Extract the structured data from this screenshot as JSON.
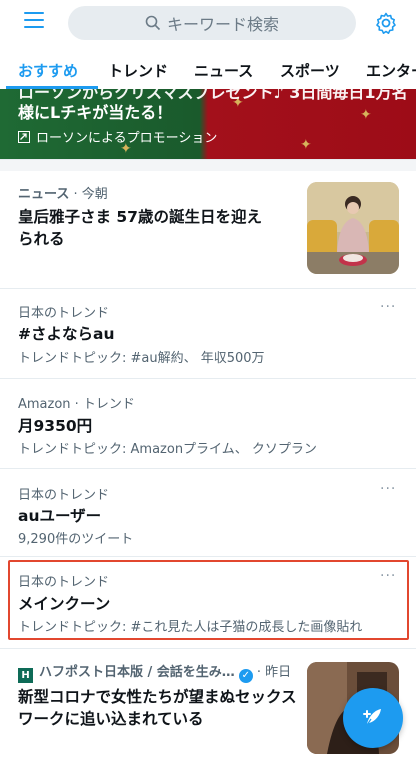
{
  "header": {
    "search_placeholder": "キーワード検索"
  },
  "tabs": [
    {
      "label": "おすすめ",
      "active": true
    },
    {
      "label": "トレンド",
      "active": false
    },
    {
      "label": "ニュース",
      "active": false
    },
    {
      "label": "スポーツ",
      "active": false
    },
    {
      "label": "エンター",
      "active": false
    }
  ],
  "promo": {
    "line1": "ローソンからクリスマスプレゼント♪ 3日間毎日1万名",
    "line2": "様にLチキが当たる！",
    "sponsor": "ローソンによるプロモーション"
  },
  "items": [
    {
      "meta_category": "ニュース",
      "meta_time": "今朝",
      "title_line1": "皇后雅子さま 57歳の誕生日を迎え",
      "title_line2": "られる"
    },
    {
      "meta": "日本のトレンド",
      "title": "#さよならau",
      "sub": "トレンドトピック: #au解約、 年収500万"
    },
    {
      "meta": "Amazon · トレンド",
      "title": "月9350円",
      "sub": "トレンドトピック: Amazonプライム、 クソプラン"
    },
    {
      "meta": "日本のトレンド",
      "title": "auユーザー",
      "sub": "9,290件のツイート"
    },
    {
      "meta": "日本のトレンド",
      "title": "メインクーン",
      "sub": "トレンドトピック: #これ見た人は子猫の成長した画像貼れ"
    },
    {
      "meta_source": "ハフポスト日本版 / 会話を生み…",
      "meta_time": "昨日",
      "title_line1": "新型コロナで女性たちが望まぬセックス",
      "title_line2": "ワークに追い込まれている"
    }
  ],
  "more_label": "···",
  "colors": {
    "accent": "#1d9bf0",
    "highlight": "#e2472f"
  }
}
